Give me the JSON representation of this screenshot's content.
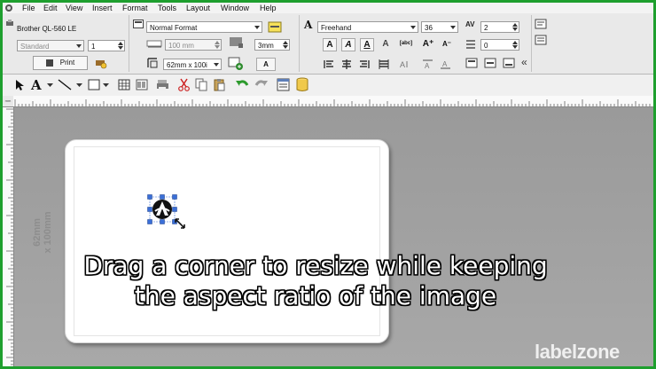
{
  "menu": {
    "items": [
      "File",
      "Edit",
      "View",
      "Insert",
      "Format",
      "Tools",
      "Layout",
      "Window",
      "Help"
    ]
  },
  "printer_group": {
    "printer_name": "Brother QL-560 LE",
    "mode": "Standard",
    "copies": "1",
    "print_label": "Print"
  },
  "layout_group": {
    "format": "Normal Format",
    "length": "100 mm",
    "margin": "3mm",
    "label_size": "62mm x 100i"
  },
  "text_group": {
    "font": "Freehand",
    "font_size": "36",
    "char_spacing": "2",
    "line_spacing": "0"
  },
  "label": {
    "size_line1": "62mm",
    "size_line2": "x 100mm"
  },
  "caption": {
    "line1": "Drag a corner to resize while keeping",
    "line2": "the aspect ratio of the image"
  },
  "logo": {
    "part1": "label",
    "part2": "zone"
  },
  "colors": {
    "frame": "#1e9f2e",
    "canvas": "#9a9a9a",
    "selection_handle": "#3a6fd8"
  }
}
